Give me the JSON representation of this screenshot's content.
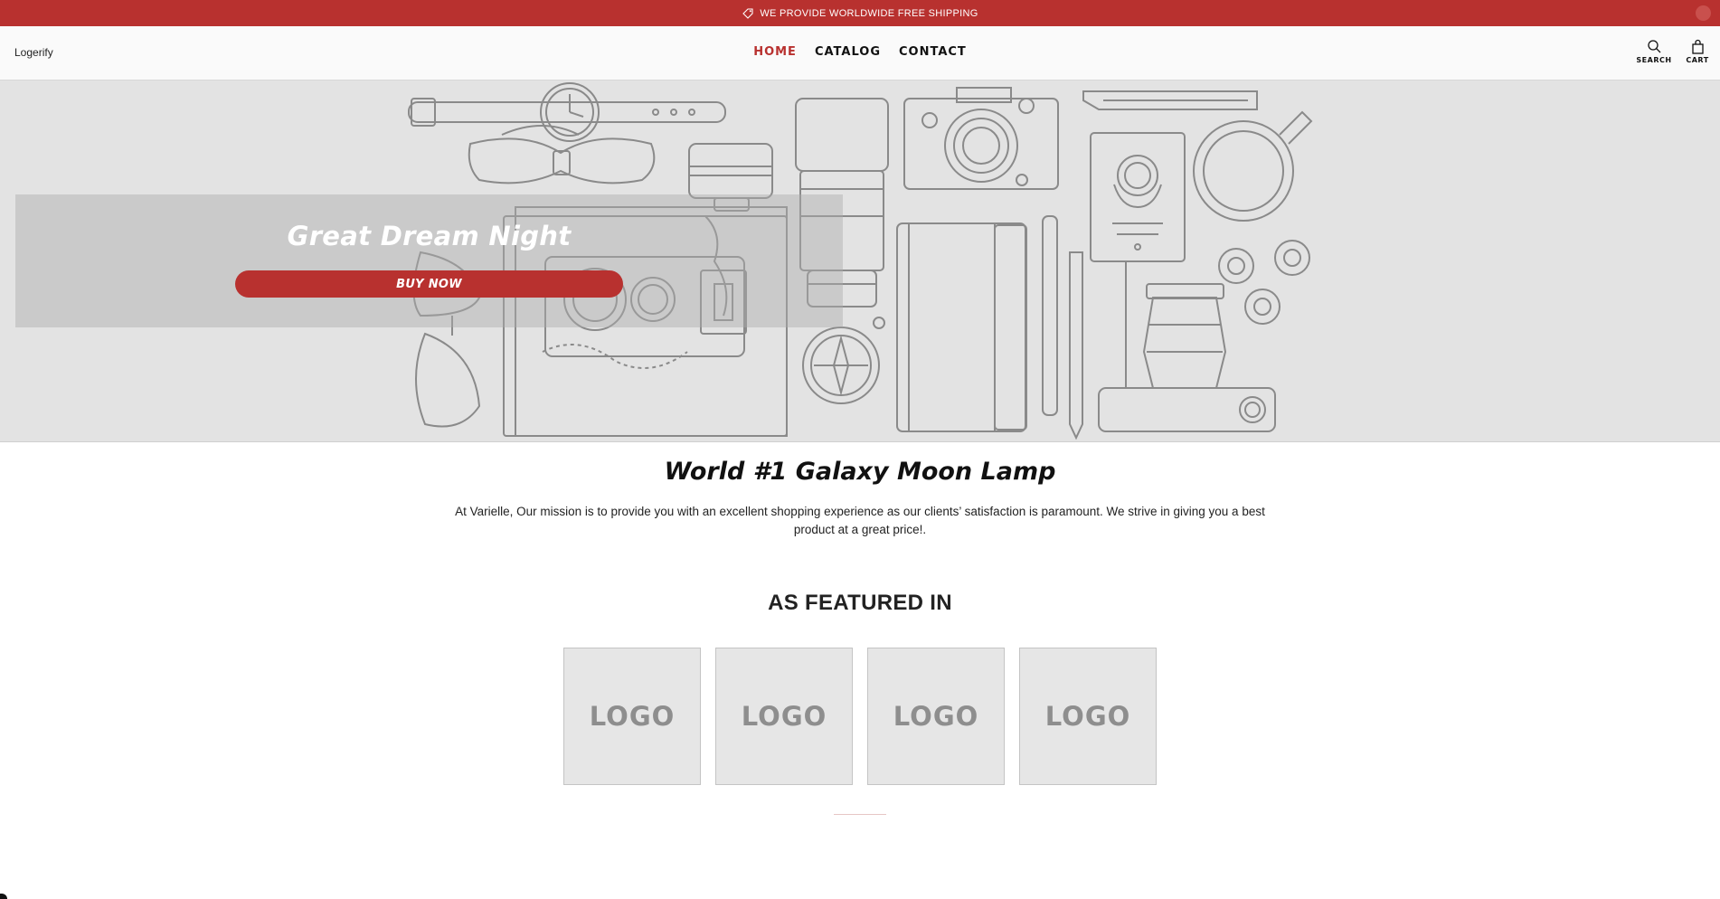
{
  "announcement": {
    "text": "WE PROVIDE WORLDWIDE FREE SHIPPING",
    "icon": "tag-icon"
  },
  "header": {
    "brand": "Logerify",
    "nav": [
      {
        "label": "HOME",
        "active": true
      },
      {
        "label": "CATALOG",
        "active": false
      },
      {
        "label": "CONTACT",
        "active": false
      }
    ],
    "tools": {
      "search_label": "SEARCH",
      "cart_label": "CART"
    }
  },
  "hero": {
    "title": "Great Dream Night",
    "button_label": "BUY NOW"
  },
  "main": {
    "headline": "World #1 Galaxy Moon Lamp",
    "mission": "At Varielle, Our mission is to provide you with an excellent shopping experience as our clients’ satisfaction is paramount. We strive in giving you a best product at a great price!.",
    "featured_title": "AS FEATURED IN",
    "logos": [
      "LOGO",
      "LOGO",
      "LOGO",
      "LOGO"
    ]
  },
  "colors": {
    "accent": "#b8312f",
    "hero_bg": "#e3e3e3",
    "line_art": "#8a8a8a"
  }
}
